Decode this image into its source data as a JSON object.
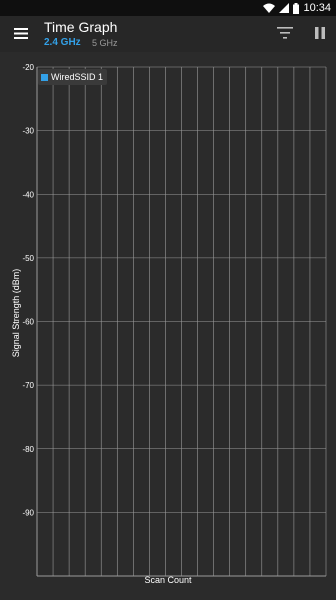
{
  "status_bar": {
    "time": "10:34"
  },
  "app_bar": {
    "title": "Time Graph",
    "bands": [
      {
        "label": "2.4 GHz",
        "selected": true
      },
      {
        "label": "5 GHz",
        "selected": false
      }
    ]
  },
  "colors": {
    "accent": "#33a1e8",
    "grid": "#9b9b9b",
    "background": "#2b2b2b"
  },
  "icons": [
    "menu-icon",
    "filter-icon",
    "pause-icon",
    "wifi-icon",
    "signal-icon",
    "battery-icon"
  ],
  "chart_data": {
    "type": "line",
    "xlabel": "Scan Count",
    "ylabel": "Signal Strength (dBm)",
    "ylim": [
      -100,
      -20
    ],
    "yticks": [
      -20,
      -30,
      -40,
      -50,
      -60,
      -70,
      -80,
      -90
    ],
    "grid": true,
    "legend_position": "top-left",
    "series": [
      {
        "name": "WiredSSID 1",
        "color": "#33a1e8",
        "values": []
      }
    ]
  }
}
